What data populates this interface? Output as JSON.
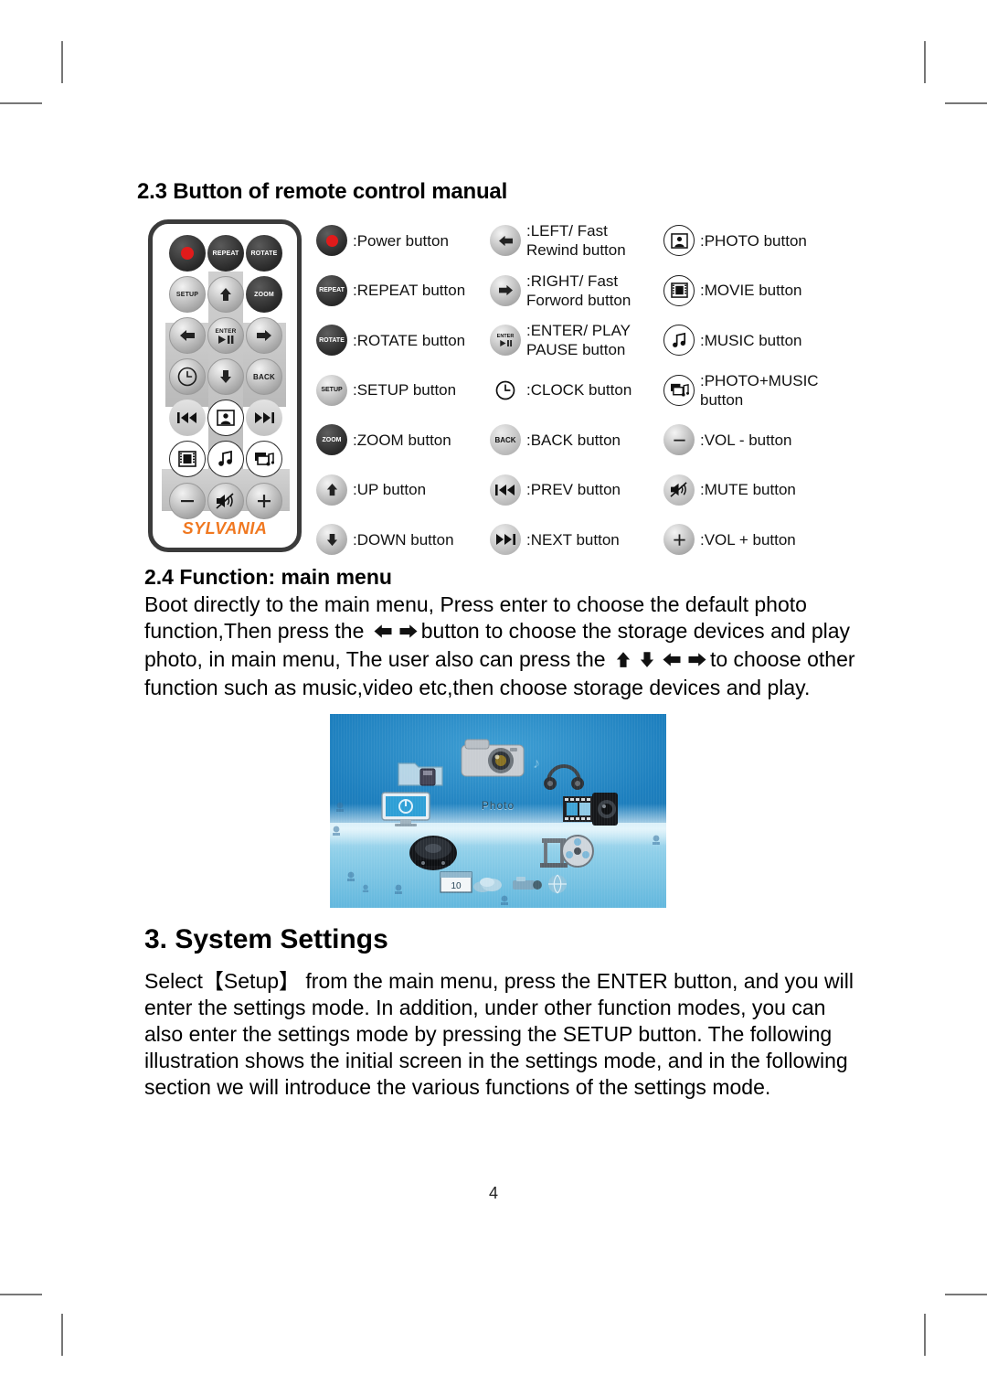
{
  "document": {
    "page_number": "4"
  },
  "section_23": {
    "heading_prefix": "2.3 Button of re",
    "heading_mid": "m",
    "heading_suffix": "ote control manual"
  },
  "remote": {
    "brand": "SYLVANIA",
    "buttons": [
      {
        "name": "power",
        "label": ""
      },
      {
        "name": "repeat",
        "label": "REPEAT"
      },
      {
        "name": "rotate",
        "label": "ROTATE"
      },
      {
        "name": "setup",
        "label": "SETUP"
      },
      {
        "name": "up",
        "label": ""
      },
      {
        "name": "zoom",
        "label": "ZOOM"
      },
      {
        "name": "left",
        "label": ""
      },
      {
        "name": "enter",
        "label": "ENTER"
      },
      {
        "name": "right",
        "label": ""
      },
      {
        "name": "clock",
        "label": ""
      },
      {
        "name": "down",
        "label": ""
      },
      {
        "name": "back",
        "label": "BACK"
      },
      {
        "name": "prev",
        "label": ""
      },
      {
        "name": "photo",
        "label": ""
      },
      {
        "name": "next",
        "label": ""
      },
      {
        "name": "movie",
        "label": ""
      },
      {
        "name": "music",
        "label": ""
      },
      {
        "name": "photo-music",
        "label": ""
      },
      {
        "name": "vol-minus",
        "label": ""
      },
      {
        "name": "mute",
        "label": ""
      },
      {
        "name": "vol-plus",
        "label": ""
      }
    ]
  },
  "legend": {
    "column1": [
      {
        "icon": "power-icon",
        "icon_label": "",
        "text": ":Power button"
      },
      {
        "icon": "repeat-icon",
        "icon_label": "REPEAT",
        "text": ":REPEAT button"
      },
      {
        "icon": "rotate-icon",
        "icon_label": "ROTATE",
        "text": ":ROTATE button"
      },
      {
        "icon": "setup-icon",
        "icon_label": "SETUP",
        "text": ":SETUP button"
      },
      {
        "icon": "zoom-icon",
        "icon_label": "ZOOM",
        "text": ":ZOOM button"
      },
      {
        "icon": "up-arrow-icon",
        "icon_label": "",
        "text": ":UP button"
      },
      {
        "icon": "down-arrow-icon",
        "icon_label": "",
        "text": ":DOWN button"
      }
    ],
    "column2": [
      {
        "icon": "left-arrow-icon",
        "icon_label": "",
        "text": ":LEFT/ Fast\nRewind button"
      },
      {
        "icon": "right-arrow-icon",
        "icon_label": "",
        "text": ":RIGHT/ Fast\nForword button"
      },
      {
        "icon": "enter-icon",
        "icon_label": "ENTER",
        "text": ":ENTER/ PLAY\nPAUSE button"
      },
      {
        "icon": "clock-icon",
        "icon_label": "",
        "text": ":CLOCK button"
      },
      {
        "icon": "back-icon",
        "icon_label": "BACK",
        "text": ":BACK button"
      },
      {
        "icon": "prev-icon",
        "icon_label": "",
        "text": ":PREV button"
      },
      {
        "icon": "next-icon",
        "icon_label": "",
        "text": ":NEXT button"
      }
    ],
    "column3": [
      {
        "icon": "photo-icon",
        "icon_label": "",
        "text": ":PHOTO button"
      },
      {
        "icon": "movie-icon",
        "icon_label": "",
        "text": ":MOVIE button"
      },
      {
        "icon": "music-icon",
        "icon_label": "",
        "text": ":MUSIC button"
      },
      {
        "icon": "photo-music-icon",
        "icon_label": "",
        "text": ":PHOTO+MUSIC\nbutton"
      },
      {
        "icon": "vol-minus-icon",
        "icon_label": "",
        "text": ":VOL -  button"
      },
      {
        "icon": "mute-icon",
        "icon_label": "",
        "text": ":MUTE button"
      },
      {
        "icon": "vol-plus-icon",
        "icon_label": "",
        "text": ":VOL +  button"
      }
    ]
  },
  "section_24": {
    "heading": "2.4 Function: main menu",
    "para_part1": "Boot directly to the main menu, Press enter to choose the default photo function,Then press the ",
    "para_part2": "button to choose the storage devices and play photo, in main menu, The user also can press the ",
    "para_part3": "to choose other function such as music,video etc,then choose storage devices and play."
  },
  "device_screen": {
    "caption": "Photo"
  },
  "section_3": {
    "heading": "3. System Settings",
    "paragraph": "Select【Setup】 from the main menu, press the ENTER button, and you will enter the settings mode. In addition, under other function modes, you can also enter the settings mode by pressing the SETUP button. The following illustration shows the initial screen in the settings mode, and in the following section we will introduce the various functions of the settings mode."
  },
  "colors": {
    "brand_orange": "#f07820",
    "power_red": "#e11b1b",
    "button_dark": "#282828",
    "button_light": "#c8c8c8"
  }
}
